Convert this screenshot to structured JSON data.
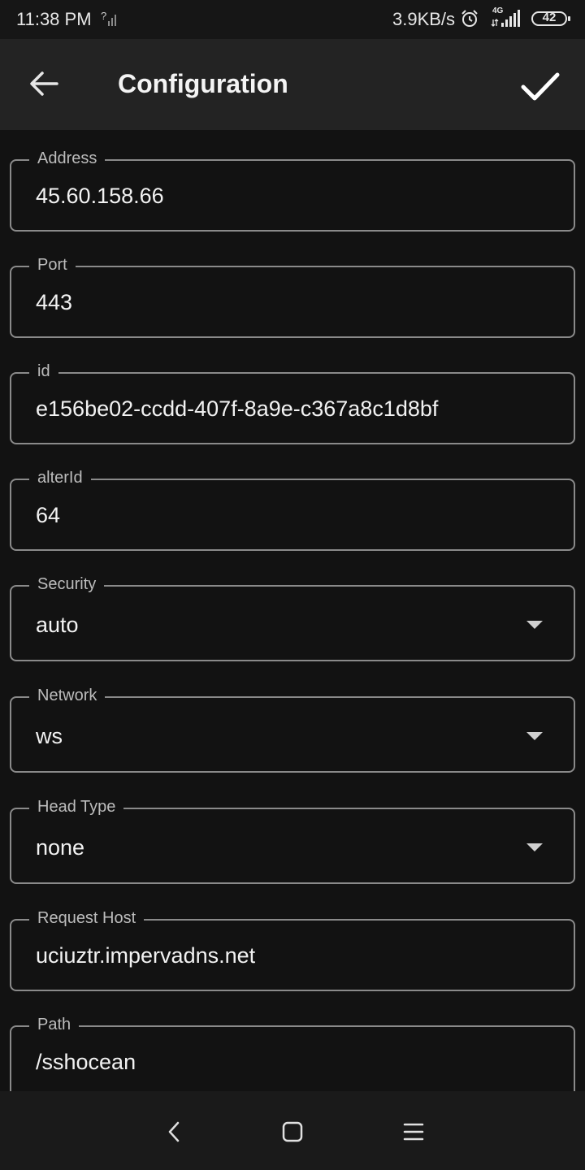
{
  "status_bar": {
    "time": "11:38 PM",
    "speed": "3.9KB/s",
    "network_type": "4G",
    "battery": "42"
  },
  "app_bar": {
    "title": "Configuration",
    "back_icon": "arrow-left-icon",
    "confirm_icon": "check-icon"
  },
  "fields": [
    {
      "label": "Address",
      "value": "45.60.158.66"
    },
    {
      "label": "Port",
      "value": "443"
    },
    {
      "label": "id",
      "value": "e156be02-ccdd-407f-8a9e-c367a8c1d8bf"
    },
    {
      "label": "alterId",
      "value": "64"
    },
    {
      "label": "Security",
      "value": "auto"
    },
    {
      "label": "Network",
      "value": "ws"
    },
    {
      "label": "Head Type",
      "value": "none"
    },
    {
      "label": "Request Host",
      "value": "uciuztr.impervadns.net"
    },
    {
      "label": "Path",
      "value": "/sshocean"
    }
  ],
  "nav_bar": {
    "back_icon": "nav-back-icon",
    "home_icon": "nav-home-icon",
    "recents_icon": "nav-menu-icon"
  }
}
